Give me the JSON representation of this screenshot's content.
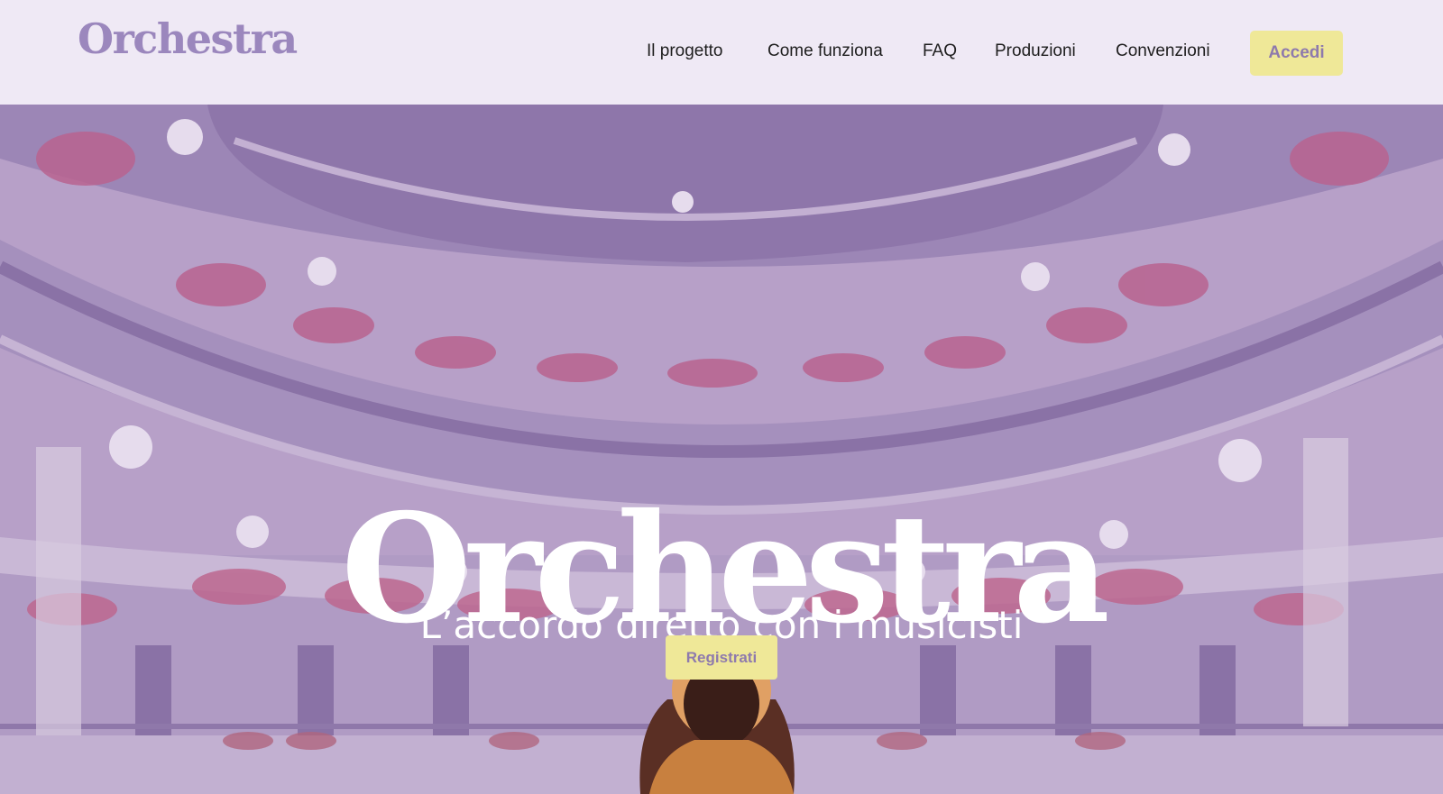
{
  "header": {
    "logo": "Orchestra",
    "nav": [
      {
        "label": "Il progetto"
      },
      {
        "label": "Come funziona"
      },
      {
        "label": "FAQ"
      },
      {
        "label": "Produzioni"
      },
      {
        "label": "Convenzioni"
      }
    ],
    "login_label": "Accedi"
  },
  "hero": {
    "title": "Orchestra",
    "subtitle": "L’accordo diretto con i musicisti",
    "cta_label": "Registrati"
  },
  "colors": {
    "header_bg": "#efe9f5",
    "brand_purple": "#9b87bd",
    "overlay_purple": "#a98ec0",
    "button_yellow": "#efe898",
    "button_text": "#8e7aad"
  }
}
